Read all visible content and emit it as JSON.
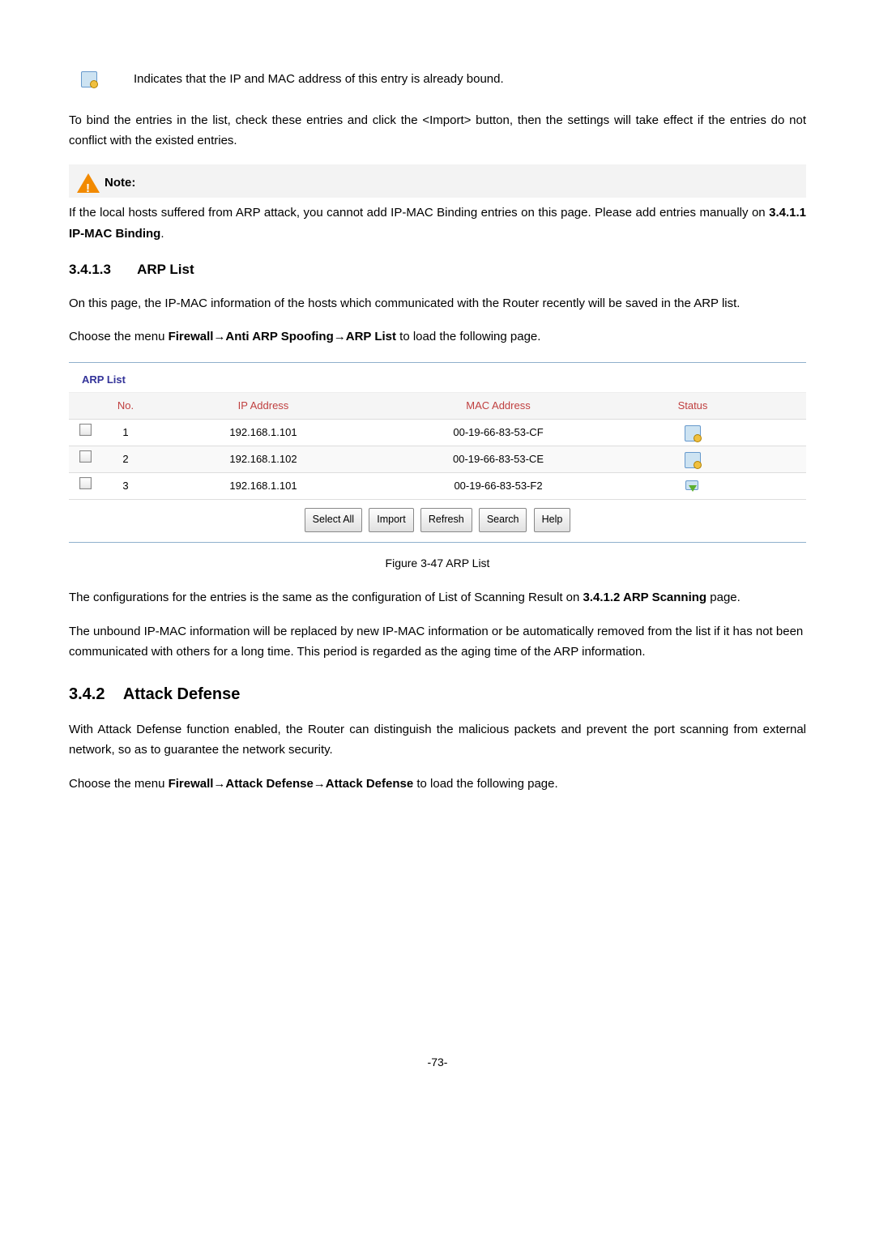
{
  "intro": {
    "bound_line": "Indicates that the IP and MAC address of this entry is already bound.",
    "import_para": "To bind the entries in the list, check these entries and click the <Import> button, then the settings will take effect if the entries do not conflict with the existed entries."
  },
  "note": {
    "label": "Note:",
    "part1": "If the local hosts suffered from ARP attack, you cannot add IP-MAC Binding entries on this page. Please add entries manually on ",
    "bold": "3.4.1.1 IP-MAC Binding",
    "part2": "."
  },
  "section_arp": {
    "num": "3.4.1.3",
    "title": "ARP List",
    "para1": "On this page, the IP-MAC information of the hosts which communicated with the Router recently will be saved in the ARP list.",
    "menu_pre": "Choose the menu ",
    "menu_bold": "Firewall→Anti ARP Spoofing→ARP List",
    "menu_post": " to load the following page."
  },
  "arp_figure": {
    "title": "ARP List",
    "headers": {
      "no": "No.",
      "ip": "IP Address",
      "mac": "MAC Address",
      "st": "Status"
    },
    "rows": [
      {
        "no": "1",
        "ip": "192.168.1.101",
        "mac": "00-19-66-83-53-CF",
        "status": "bound"
      },
      {
        "no": "2",
        "ip": "192.168.1.102",
        "mac": "00-19-66-83-53-CE",
        "status": "bound"
      },
      {
        "no": "3",
        "ip": "192.168.1.101",
        "mac": "00-19-66-83-53-F2",
        "status": "download"
      }
    ],
    "buttons": {
      "selectall": "Select All",
      "import": "Import",
      "refresh": "Refresh",
      "search": "Search",
      "help": "Help"
    },
    "caption": "Figure 3-47 ARP List"
  },
  "after_fig": {
    "p1a": "The configurations for the entries is the same as the configuration of List of Scanning Result on ",
    "p1b": "3.4.1.2 ARP Scanning",
    "p1c": " page.",
    "p2": "The unbound IP-MAC information will be replaced by new IP-MAC information or be automatically removed from the list if it has not been communicated with others for a long time. This period is regarded as the aging time of the ARP information."
  },
  "section_attack": {
    "num": "3.4.2",
    "title": "Attack Defense",
    "para": "With Attack Defense function enabled, the Router can distinguish the malicious packets and prevent the port scanning from external network, so as to guarantee the network security.",
    "menu_pre": "Choose the menu ",
    "menu_bold": "Firewall→Attack Defense→Attack Defense",
    "menu_post": " to load the following page."
  },
  "page_number": "-73-"
}
